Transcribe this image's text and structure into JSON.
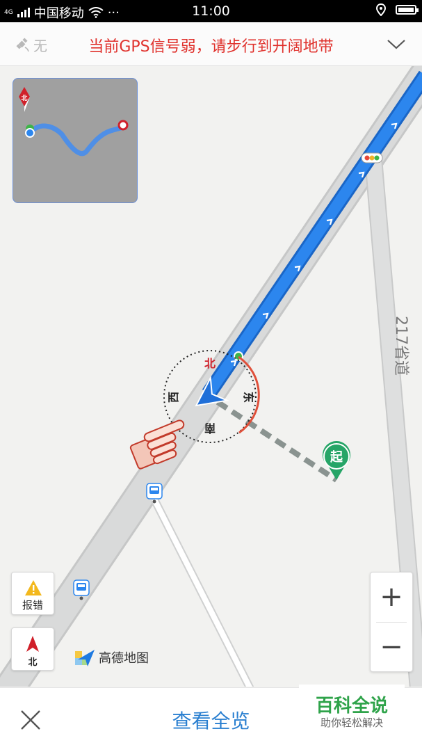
{
  "status_bar": {
    "network": "4G",
    "carrier": "中国移动",
    "more": "···",
    "time": "11:00"
  },
  "gps_bar": {
    "signal_status": "无",
    "message": "当前GPS信号弱，请步行到开阔地带"
  },
  "map": {
    "road_label": "217省道",
    "start_marker": "起",
    "compass": {
      "north": "北",
      "east": "东",
      "south": "南",
      "west": "西"
    },
    "overview_north": "北"
  },
  "controls": {
    "report_label": "报错",
    "compass_label": "北",
    "zoom_in": "+",
    "zoom_out": "−"
  },
  "logo": {
    "text": "高德地图"
  },
  "bottom_bar": {
    "overview_button": "查看全览"
  },
  "watermark": {
    "title": "百科全说",
    "subtitle": "助你轻松解决"
  },
  "colors": {
    "route": "#2c86ee",
    "alert": "#e0322d",
    "link": "#2a7fd0",
    "start_marker": "#26a567"
  }
}
